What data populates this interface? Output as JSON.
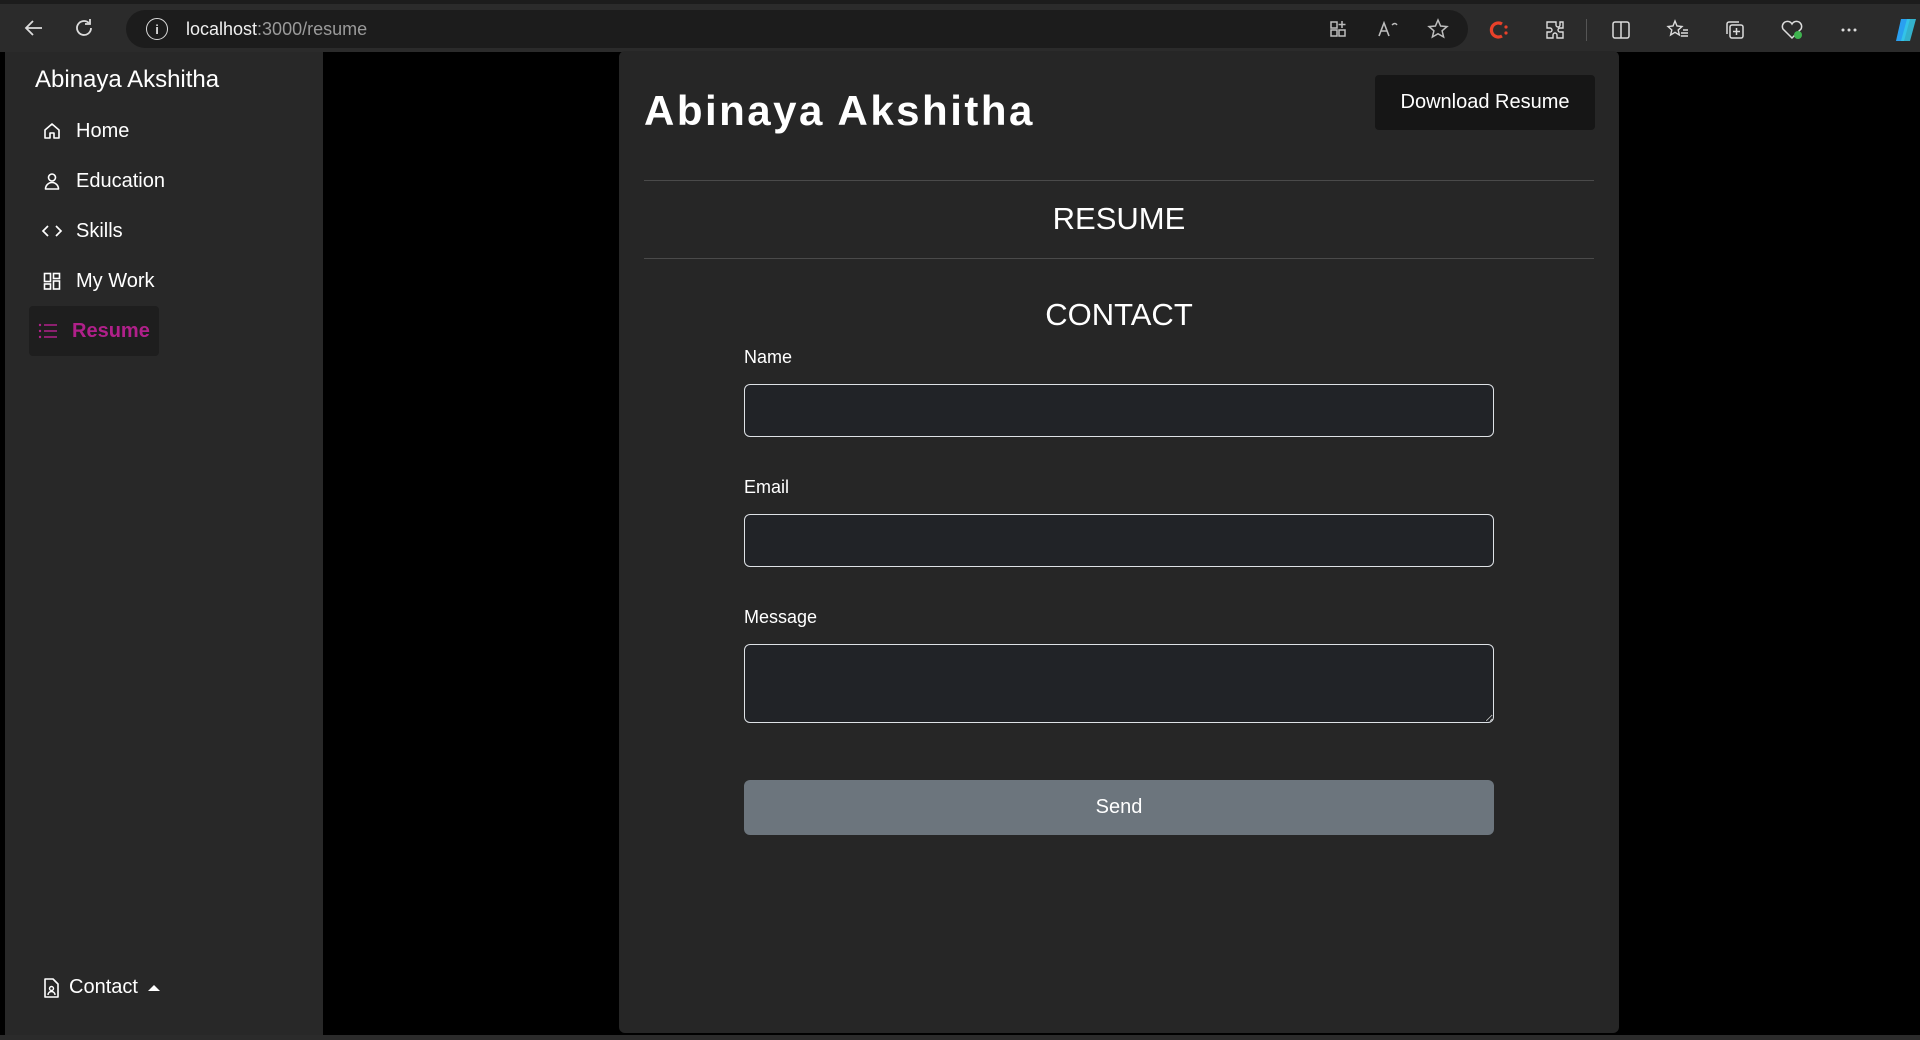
{
  "browser": {
    "url_host": "localhost",
    "url_path": ":3000/resume",
    "info_icon": "info-icon",
    "toolbar_icons": [
      "app-available-icon",
      "read-aloud-icon",
      "favorite-star-icon",
      "extension-c-icon",
      "extensions-icon",
      "split-screen-icon",
      "favorites-icon",
      "collections-icon",
      "browser-essentials-icon",
      "more-icon",
      "copilot-icon"
    ]
  },
  "sidebar": {
    "brand": "Abinaya Akshitha",
    "items": [
      {
        "label": "Home",
        "icon": "home-icon"
      },
      {
        "label": "Education",
        "icon": "user-icon"
      },
      {
        "label": "Skills",
        "icon": "code-icon"
      },
      {
        "label": "My Work",
        "icon": "grid-icon"
      },
      {
        "label": "Resume",
        "icon": "list-icon",
        "active": true
      }
    ],
    "contact_label": "Contact",
    "active_color": "#b0208a"
  },
  "main": {
    "title": "Abinaya Akshitha",
    "download_label": "Download Resume",
    "resume_heading": "RESUME",
    "contact_heading": "CONTACT",
    "form": {
      "name_label": "Name",
      "name_value": "",
      "email_label": "Email",
      "email_value": "",
      "message_label": "Message",
      "message_value": "",
      "send_label": "Send"
    }
  },
  "colors": {
    "background": "#000000",
    "card": "#262626",
    "sidebar": "#282828",
    "send_button": "#6c757d"
  }
}
